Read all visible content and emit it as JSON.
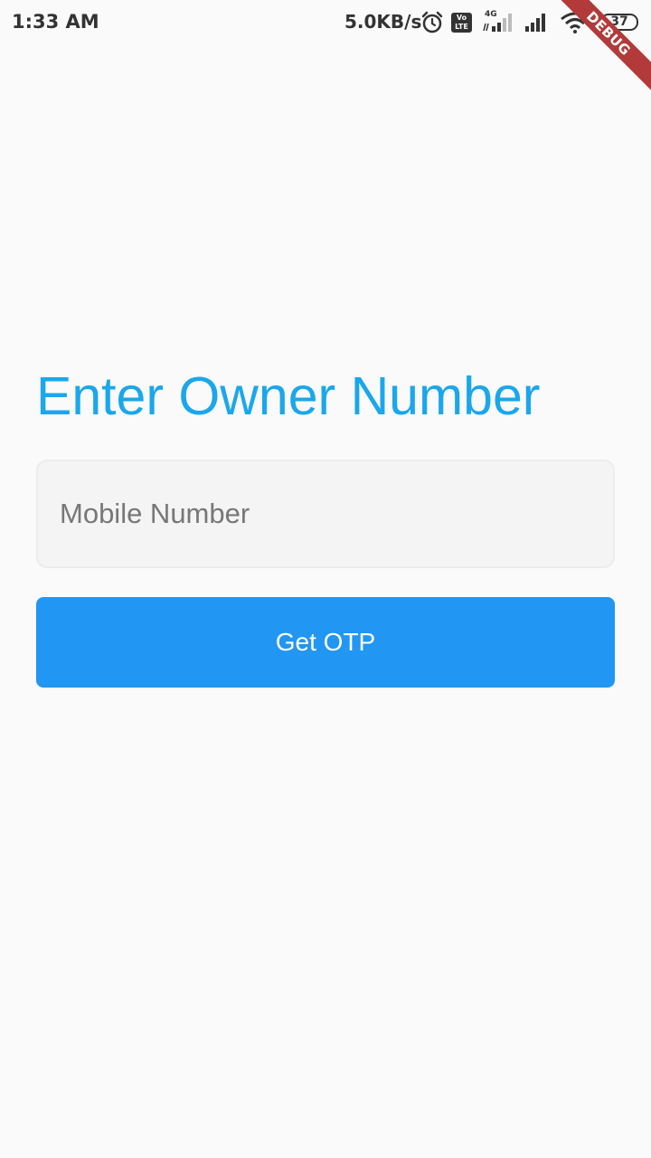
{
  "status_bar": {
    "time": "1:33 AM",
    "net_speed": "5.0KB/s",
    "volte_label": "Vo\nLTE",
    "network_type": "4G",
    "battery": "37",
    "icons": [
      "alarm-icon",
      "volte-icon",
      "signal-icon",
      "signal-icon",
      "wifi-icon",
      "battery-icon"
    ]
  },
  "debug_banner": "DEBUG",
  "main": {
    "title": "Enter Owner Number",
    "mobile_input": {
      "placeholder": "Mobile Number",
      "value": ""
    },
    "otp_button_label": "Get OTP"
  },
  "colors": {
    "title": "#1aa7ec",
    "button": "#2196f3",
    "background": "#fafafa",
    "debug": "#b23a3a"
  }
}
